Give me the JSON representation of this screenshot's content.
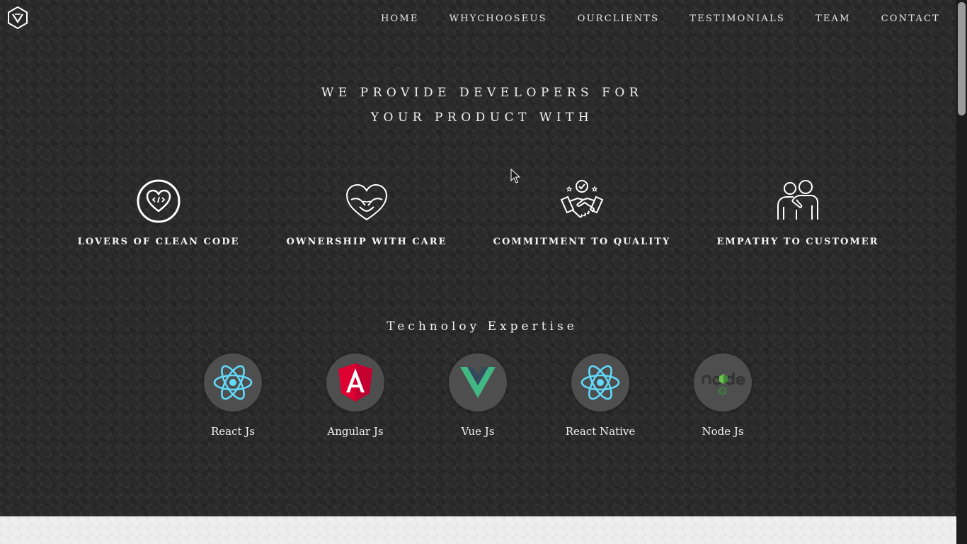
{
  "nav": {
    "items": [
      "HOME",
      "WHYCHOOSEUS",
      "OURCLIENTS",
      "TESTIMONIALS",
      "TEAM",
      "CONTACT"
    ]
  },
  "hero": {
    "line1": "WE PROVIDE DEVELOPERS FOR",
    "line2": "YOUR PRODUCT WITH"
  },
  "features": [
    {
      "label": "LOVERS OF CLEAN CODE",
      "icon": "heart-code-icon"
    },
    {
      "label": "OWNERSHIP WITH CARE",
      "icon": "heart-hug-icon"
    },
    {
      "label": "COMMITMENT TO QUALITY",
      "icon": "handshake-icon"
    },
    {
      "label": "EMPATHY TO CUSTOMER",
      "icon": "people-hug-icon"
    }
  ],
  "tech": {
    "title": "Technoloy Expertise",
    "items": [
      {
        "label": "React Js",
        "icon": "react-icon"
      },
      {
        "label": "Angular Js",
        "icon": "angular-icon"
      },
      {
        "label": "Vue Js",
        "icon": "vue-icon"
      },
      {
        "label": "React Native",
        "icon": "react-icon"
      },
      {
        "label": "Node Js",
        "icon": "node-icon"
      }
    ]
  },
  "colors": {
    "react": "#61dafb",
    "angular": "#dd0031",
    "vue_green": "#41b883",
    "vue_dark": "#35495e",
    "node": "#3c873a"
  }
}
